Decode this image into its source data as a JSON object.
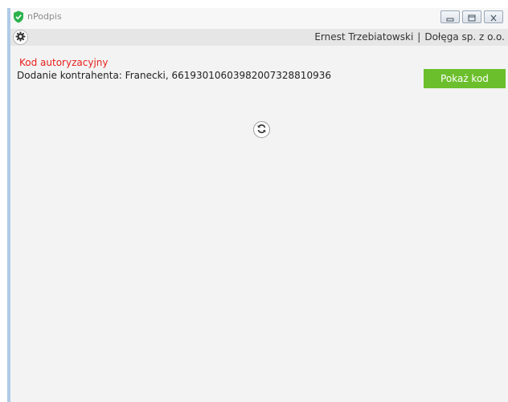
{
  "window": {
    "title": "nPodpis"
  },
  "header": {
    "user_name": "Ernest Trzebiatowski",
    "separator": "|",
    "company": "Dołęga sp. z o.o."
  },
  "content": {
    "auth_title": "Kod autoryzacyjny",
    "description": "Dodanie kontrahenta: Franecki, 66193010603982007328810936",
    "show_code_label": "Pokaż kod"
  },
  "colors": {
    "accent_green": "#6cbf2c",
    "title_red": "#e8201c",
    "shield_green": "#2bb24c"
  },
  "icons": {
    "app": "shield-icon",
    "settings": "gear-icon",
    "refresh": "refresh-icon",
    "minimize": "minimize-icon",
    "maximize": "maximize-icon",
    "close": "close-icon"
  }
}
